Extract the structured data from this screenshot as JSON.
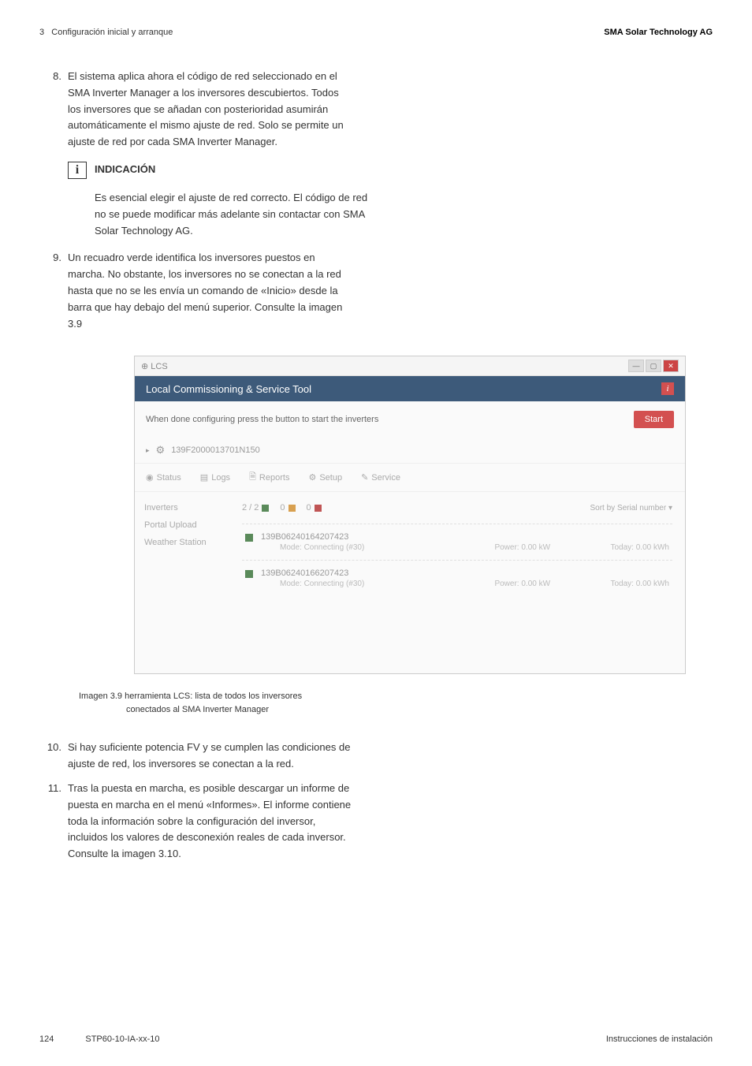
{
  "header": {
    "section_num": "3",
    "section_title": "Configuración inicial y arranque",
    "company": "SMA Solar Technology AG"
  },
  "item8": {
    "num": "8.",
    "text": "El sistema aplica ahora el código de red seleccionado en el SMA Inverter Manager a los inversores descubiertos. Todos los inversores que se añadan con posterioridad asumirán automáticamente el mismo ajuste de red. Solo se permite un ajuste de red por cada SMA Inverter Manager."
  },
  "info": {
    "title": "INDICACIÓN",
    "text": "Es esencial elegir el ajuste de red correcto. El código de red no se puede modificar más adelante sin contactar con SMA Solar Technology AG."
  },
  "item9": {
    "num": "9.",
    "text": "Un recuadro verde identifica los inversores puestos en marcha. No obstante, los inversores no se conectan a la red hasta que no se les envía un comando de «Inicio» desde la barra que hay debajo del menú superior. Consulte la imagen 3.9"
  },
  "screenshot": {
    "window_title": "LCS",
    "app_title": "Local Commissioning & Service Tool",
    "instruction": "When done configuring press the button to start the inverters",
    "start_btn": "Start",
    "device_id": "139F2000013701N150",
    "tabs": {
      "status": "Status",
      "logs": "Logs",
      "reports": "Reports",
      "setup": "Setup",
      "service": "Service"
    },
    "sidebar": {
      "inverters": "Inverters",
      "portal": "Portal Upload",
      "weather": "Weather Station"
    },
    "counts": {
      "green": "2 / 2",
      "orange": "0",
      "red": "0"
    },
    "sort": "Sort by   Serial number ▾",
    "inv1": {
      "serial": "139B06240164207423",
      "mode_label": "Mode:",
      "mode": "Connecting (#30)",
      "power_label": "Power:",
      "power": "0.00 kW",
      "today_label": "Today:",
      "today": "0.00 kWh"
    },
    "inv2": {
      "serial": "139B06240166207423",
      "mode_label": "Mode:",
      "mode": "Connecting (#30)",
      "power_label": "Power:",
      "power": "0.00 kW",
      "today_label": "Today:",
      "today": "0.00 kWh"
    }
  },
  "caption": {
    "line1": "Imagen 3.9 herramienta LCS: lista de todos los inversores",
    "line2": "conectados al SMA Inverter Manager"
  },
  "item10": {
    "num": "10.",
    "text": "Si hay suficiente potencia FV y se cumplen las condiciones de ajuste de red, los inversores se conectan a la red."
  },
  "item11": {
    "num": "11.",
    "text": "Tras la puesta en marcha, es posible descargar un informe de puesta en marcha en el menú «Informes». El informe contiene toda la información sobre la configuración del inversor, incluidos los valores de desconexión reales de cada inversor. Consulte la imagen 3.10."
  },
  "footer": {
    "page": "124",
    "doc_id": "STP60-10-IA-xx-10",
    "right": "Instrucciones de instalación"
  }
}
